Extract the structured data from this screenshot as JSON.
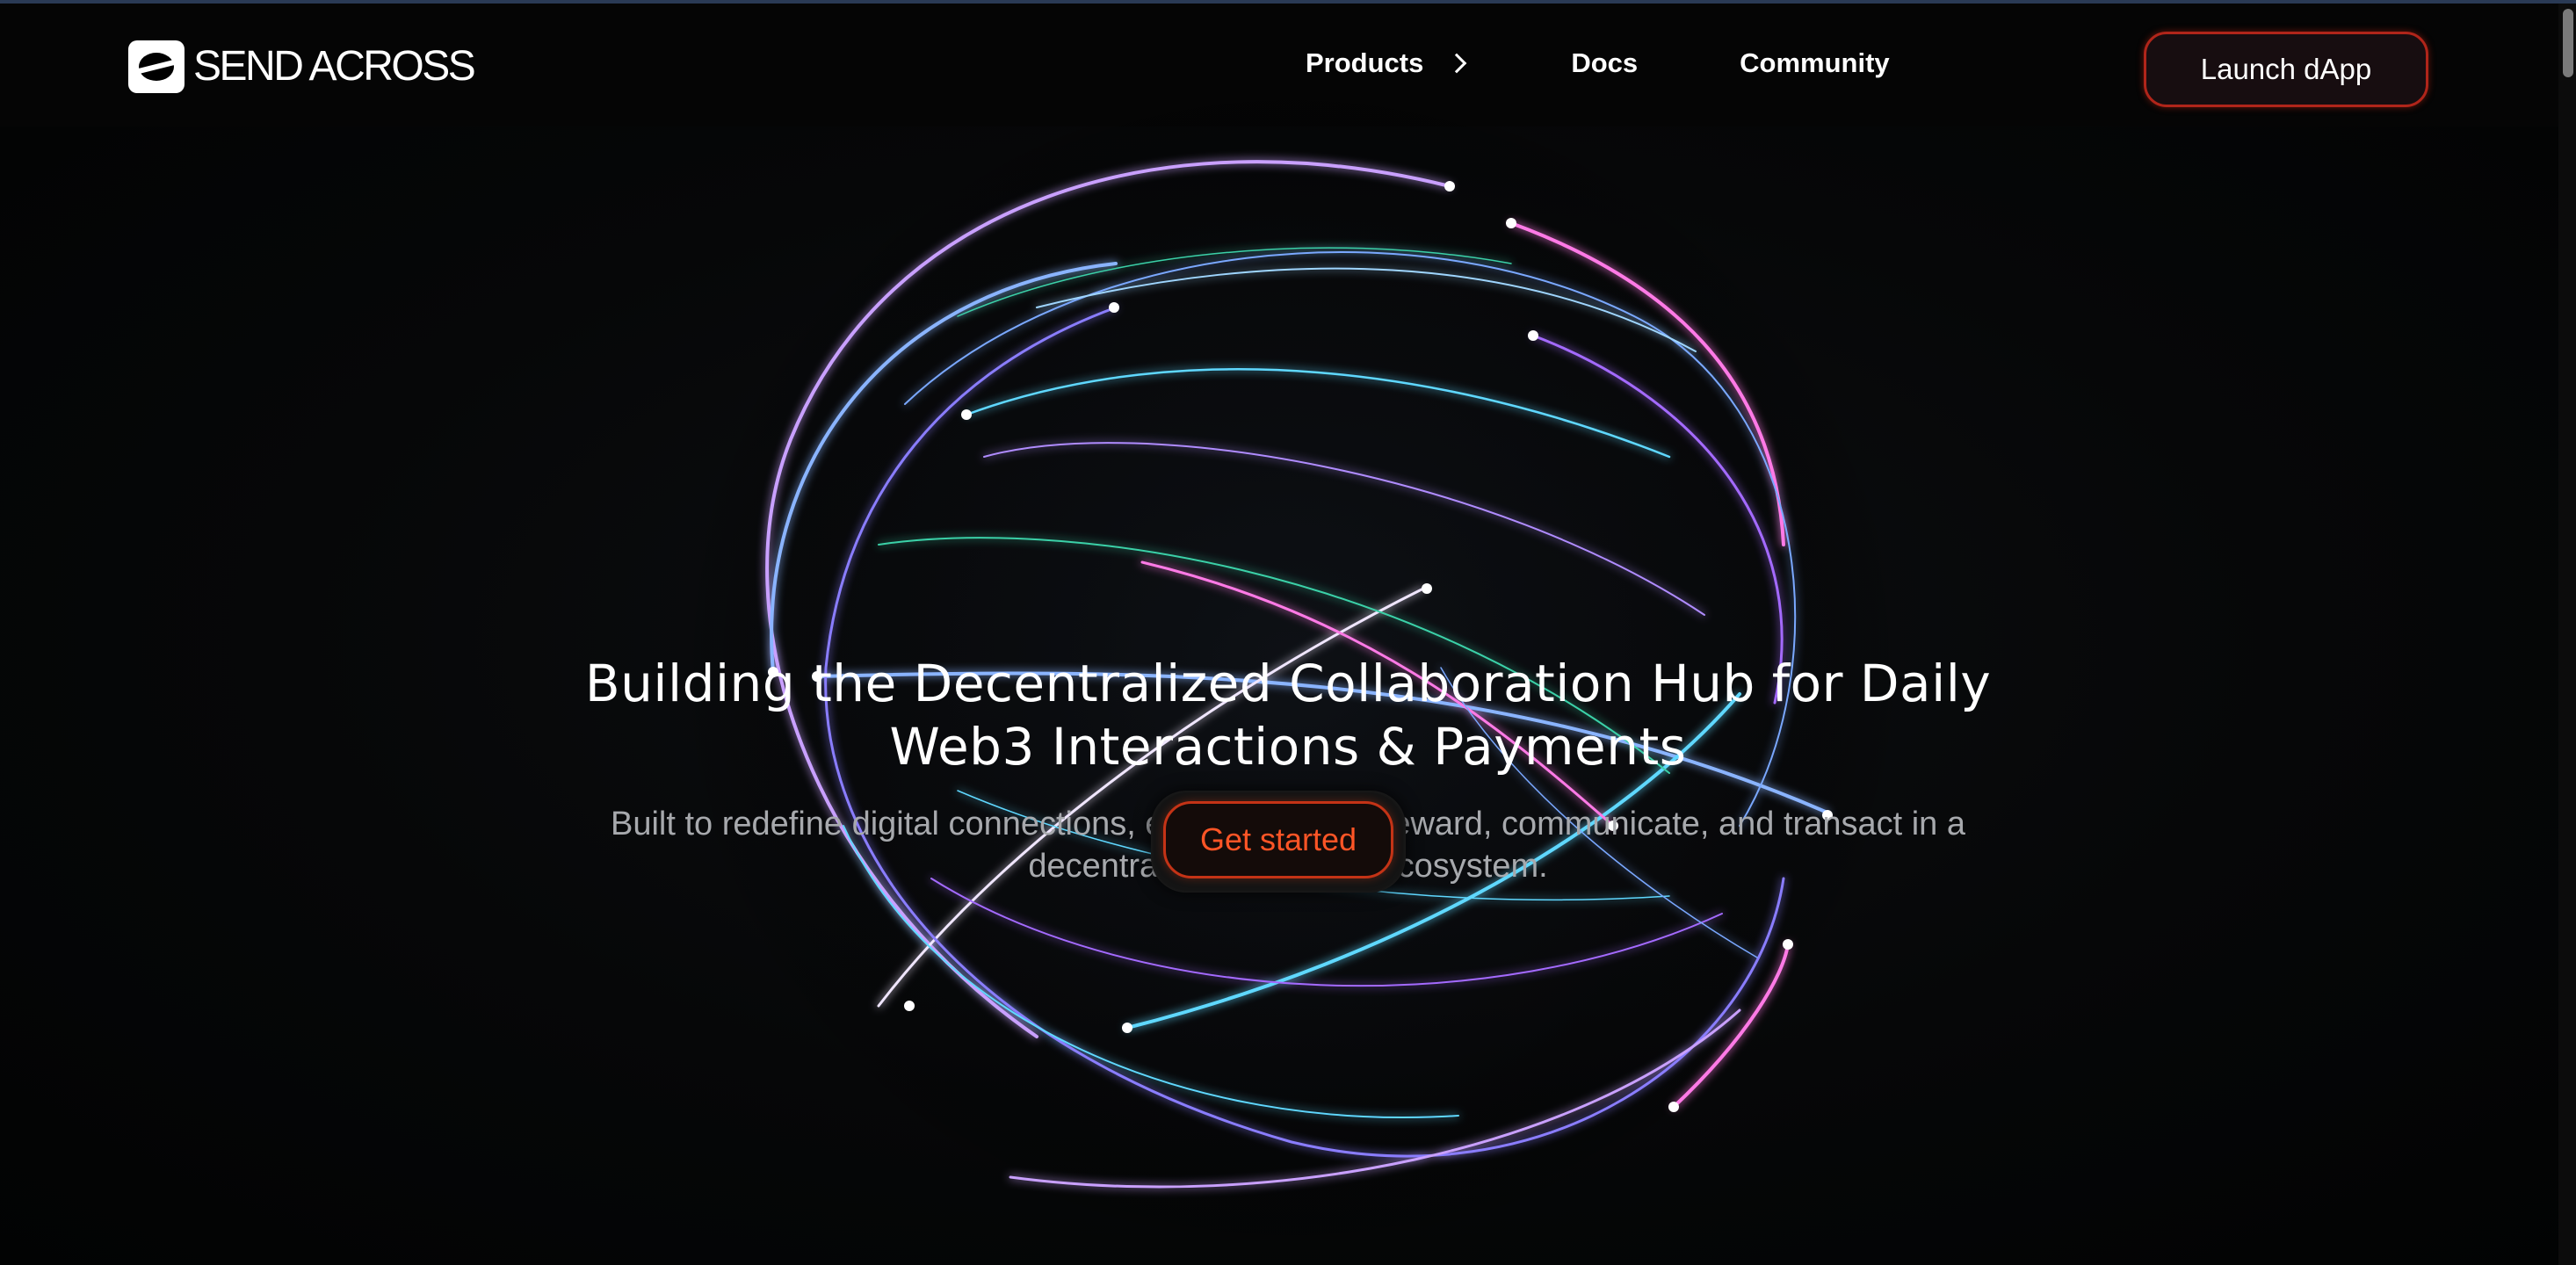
{
  "brand": {
    "name": "SEND ACROSS"
  },
  "nav": {
    "products_label": "Products",
    "docs_label": "Docs",
    "community_label": "Community",
    "launch_label": "Launch dApp"
  },
  "hero": {
    "headline_line1": "Building the Decentralized Collaboration Hub for Daily",
    "headline_line2": "Web3 Interactions & Payments",
    "subtitle_line1": "Built to redefine digital connections, enabling you to reward, communicate, and transact in a",
    "subtitle_line2": "decentralized, trustless ecosystem.",
    "cta_label": "Get started"
  },
  "colors": {
    "accent": "#ff5526",
    "button_border": "#c43316",
    "background": "#000000",
    "orb_palette": [
      "#8ab4ff",
      "#a46bff",
      "#5fd8ff",
      "#ff7ae6",
      "#3ad1a8",
      "#ffffff"
    ]
  }
}
